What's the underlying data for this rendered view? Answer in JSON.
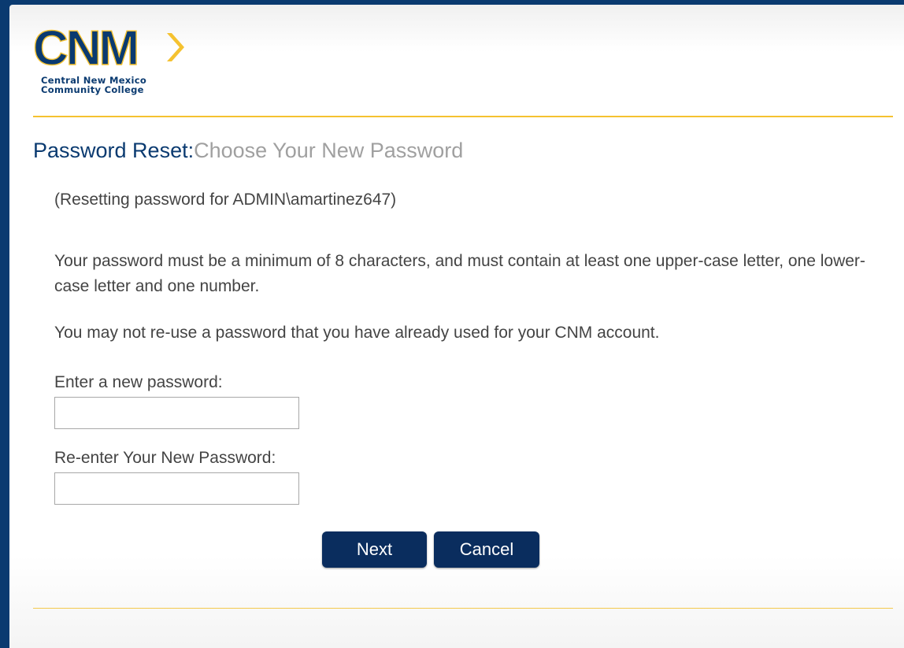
{
  "logo": {
    "mark": "CNM",
    "line1": "Central New Mexico",
    "line2": "Community College"
  },
  "page": {
    "title_main": "Password Reset:",
    "title_sub": "Choose Your New Password"
  },
  "account_line": "(Resetting password for ADMIN\\amartinez647)",
  "rules": {
    "requirements": "Your password must be a minimum of 8 characters, and must contain at least one upper-case letter, one lower-case letter and one number.",
    "reuse": "You may not re-use a password that you have already used for your CNM account."
  },
  "form": {
    "new_password_label": "Enter a new password:",
    "new_password_value": "",
    "confirm_password_label": "Re-enter Your New Password:",
    "confirm_password_value": ""
  },
  "buttons": {
    "next": "Next",
    "cancel": "Cancel"
  },
  "colors": {
    "brand_navy": "#0a3a70",
    "brand_gold": "#f5c230",
    "button_bg": "#0a2d5e"
  }
}
